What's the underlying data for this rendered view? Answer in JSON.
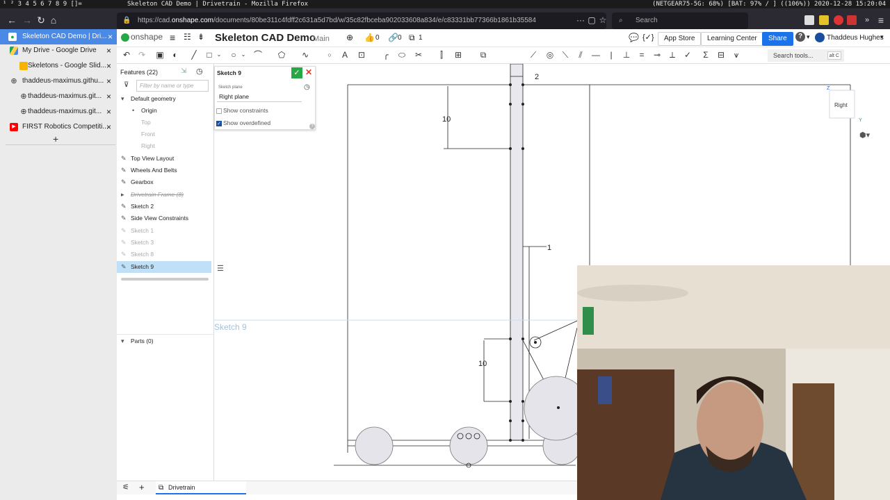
{
  "system_bar": {
    "workspaces": "¹ ² 3  4  5  6  7  8  9  []=",
    "window_title": "Skeleton CAD Demo | Drivetrain - Mozilla Firefox",
    "status": "(NETGEAR75-5G: 68%) [BAT: 97% / ] ((106%)) 2020-12-28 15:20:04"
  },
  "browser": {
    "url_prefix": "https://cad.",
    "url_host": "onshape.com",
    "url_rest": "/documents/80be311c4fdff2c631a5d7bd/w/35c82fbceba902033608a834/e/c83331bb77366b1861b35584",
    "search_placeholder": "Search"
  },
  "tabs": [
    {
      "label": "Skeleton CAD Demo | Dri...",
      "icon": "onshape-icon",
      "active": true
    },
    {
      "label": "My Drive - Google Drive",
      "icon": "google-drive-icon",
      "active": false
    },
    {
      "label": "Skeletons - Google Slid...",
      "icon": "google-slides-icon",
      "active": false
    },
    {
      "label": "thaddeus-maximus.githu...",
      "icon": "globe-icon",
      "active": false
    },
    {
      "label": "thaddeus-maximus.git...",
      "icon": "globe-icon",
      "active": false
    },
    {
      "label": "thaddeus-maximus.git...",
      "icon": "globe-icon",
      "active": false
    },
    {
      "label": "FIRST Robotics Competiti...",
      "icon": "youtube-icon",
      "active": false
    }
  ],
  "new_tab": "+",
  "onshape": {
    "logo": "onshape",
    "doc_title": "Skeleton CAD Demo",
    "branch": "Main",
    "likes": "0",
    "links": "0",
    "copies": "1",
    "app_store": "App Store",
    "learning_center": "Learning Center",
    "share": "Share",
    "help": "?",
    "user": "Thaddeus Hughes",
    "search_tools": "Search tools...",
    "search_shortcut": "alt C"
  },
  "features": {
    "header": "Features (22)",
    "filter_placeholder": "Filter by name or type",
    "items": [
      {
        "label": "Default geometry",
        "type": "group"
      },
      {
        "label": "Origin",
        "type": "origin"
      },
      {
        "label": "Top",
        "type": "plane-dim"
      },
      {
        "label": "Front",
        "type": "plane-dim"
      },
      {
        "label": "Right",
        "type": "plane-dim"
      },
      {
        "label": "Top View Layout",
        "type": "sketch"
      },
      {
        "label": "Wheels And Belts",
        "type": "sketch"
      },
      {
        "label": "Gearbox",
        "type": "sketch"
      },
      {
        "label": "Drivetrain Frame (8)",
        "type": "folder-strike"
      },
      {
        "label": "Sketch 2",
        "type": "sketch"
      },
      {
        "label": "Side View Constraints",
        "type": "sketch"
      },
      {
        "label": "Sketch 1",
        "type": "sketch-dim"
      },
      {
        "label": "Sketch 3",
        "type": "sketch-dim"
      },
      {
        "label": "Sketch 8",
        "type": "sketch-dim"
      },
      {
        "label": "Sketch 9",
        "type": "sketch-selected"
      }
    ],
    "parts": "Parts (0)"
  },
  "sketch_dialog": {
    "title": "Sketch 9",
    "plane_label": "Sketch plane",
    "plane_value": "Right plane",
    "show_constraints": "Show constraints",
    "show_overdefined": "Show overdefined",
    "show_constraints_checked": false,
    "show_overdefined_checked": true
  },
  "canvas": {
    "sketch_label": "Sketch 9",
    "dims": [
      "2",
      "10",
      "1",
      "10"
    ],
    "view_cube": "Right",
    "axis_z": "Z",
    "axis_y": "Y"
  },
  "bottom": {
    "tab": "Drivetrain"
  },
  "colors": {
    "accent": "#1a73e8",
    "onshape_green": "#27a844",
    "close_red": "#e0382b",
    "selected_row": "#bfe0f7"
  }
}
